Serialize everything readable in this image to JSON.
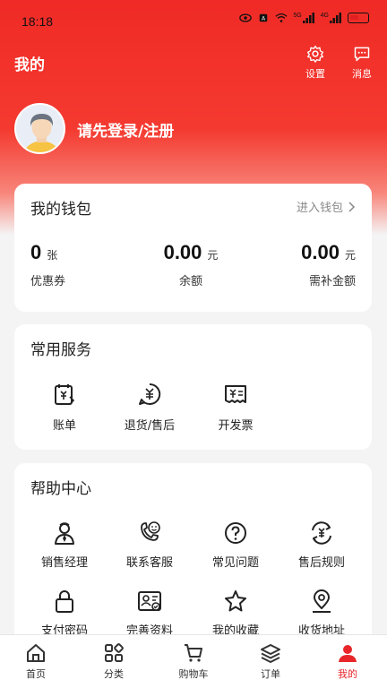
{
  "status_bar": {
    "time": "18:18",
    "signal1": "5G",
    "signal2": "4G",
    "icons": [
      "eye-icon",
      "alarm-icon",
      "wifi-icon",
      "signal-icon",
      "signal-icon",
      "battery-icon"
    ],
    "battery_color": "#e02020"
  },
  "header": {
    "title": "我的",
    "settings_label": "设置",
    "messages_label": "消息"
  },
  "profile": {
    "login_prompt": "请先登录/注册"
  },
  "wallet": {
    "title": "我的钱包",
    "enter_label": "进入钱包",
    "stats": [
      {
        "value": "0",
        "unit": "张",
        "label": "优惠券"
      },
      {
        "value": "0.00",
        "unit": "元",
        "label": "余额"
      },
      {
        "value": "0.00",
        "unit": "元",
        "label": "需补金额"
      }
    ]
  },
  "services": {
    "title": "常用服务",
    "items": [
      {
        "label": "账单",
        "icon": "bill-icon"
      },
      {
        "label": "退货/售后",
        "icon": "refund-icon"
      },
      {
        "label": "开发票",
        "icon": "invoice-icon"
      }
    ]
  },
  "help": {
    "title": "帮助中心",
    "items": [
      {
        "label": "销售经理",
        "icon": "sales-manager-icon"
      },
      {
        "label": "联系客服",
        "icon": "customer-service-icon"
      },
      {
        "label": "常见问题",
        "icon": "question-icon"
      },
      {
        "label": "售后规则",
        "icon": "after-sales-rules-icon"
      },
      {
        "label": "支付密码",
        "icon": "lock-icon"
      },
      {
        "label": "完善资料",
        "icon": "profile-card-icon"
      },
      {
        "label": "我的收藏",
        "icon": "star-icon"
      },
      {
        "label": "收货地址",
        "icon": "location-icon"
      }
    ]
  },
  "tabbar": {
    "active_color": "#e8262a",
    "items": [
      {
        "label": "首页",
        "icon": "home-icon"
      },
      {
        "label": "分类",
        "icon": "category-icon"
      },
      {
        "label": "购物车",
        "icon": "cart-icon"
      },
      {
        "label": "订单",
        "icon": "orders-icon"
      },
      {
        "label": "我的",
        "icon": "profile-icon"
      }
    ]
  },
  "theme": {
    "brand_red": "#f02a26"
  }
}
